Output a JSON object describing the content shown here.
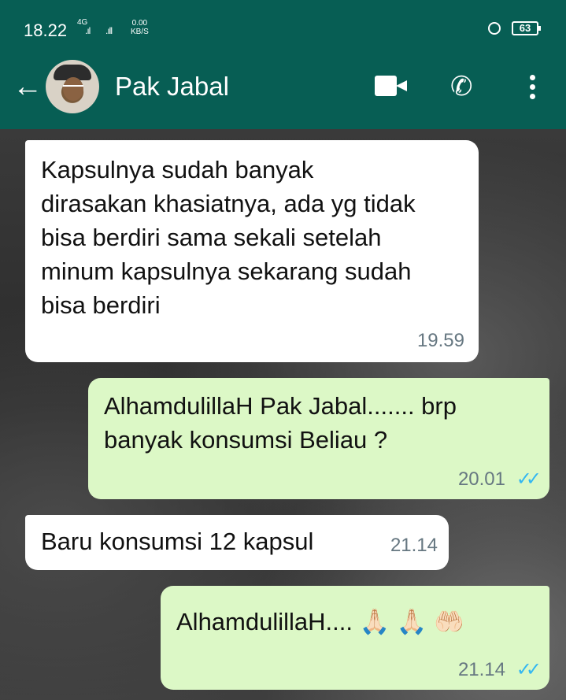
{
  "status_bar": {
    "time": "18.22",
    "network": "4G",
    "signal1": ".ıl",
    "signal2": ".ıll",
    "speed_value": "0.00",
    "speed_unit": "KB/S",
    "battery": "63"
  },
  "header": {
    "contact_name": "Pak Jabal",
    "back_icon": "arrow-left-icon",
    "video_icon": "video-camera-icon",
    "call_icon": "phone-icon",
    "more_icon": "more-vertical-icon",
    "accent_color": "#075e54"
  },
  "messages": [
    {
      "direction": "incoming",
      "text": "Kapsulnya sudah banyak dirasakan khasiatnya, ada yg tidak bisa berdiri sama sekali setelah minum kapsulnya sekarang sudah bisa berdiri",
      "time": "19.59"
    },
    {
      "direction": "outgoing",
      "text": "AlhamdulillaH  Pak Jabal....... brp banyak konsumsi Beliau ?",
      "time": "20.01",
      "status": "read"
    },
    {
      "direction": "incoming",
      "text": "Baru konsumsi 12 kapsul",
      "time": "21.14"
    },
    {
      "direction": "outgoing",
      "text": "AlhamdulillaH.... 🙏🏻 🙏🏻 🤲🏻",
      "time": "21.14",
      "status": "read"
    }
  ],
  "read_tick": "✓✓"
}
